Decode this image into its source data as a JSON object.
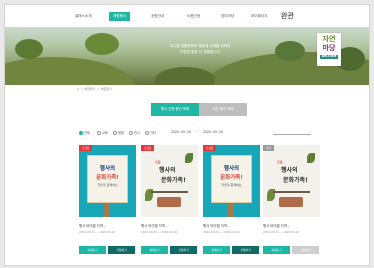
{
  "topnav": {
    "items": [
      "클래스소개",
      "체험행사",
      "공원안내",
      "이용신청",
      "참여마당",
      "마이페이지"
    ],
    "active_index": 1,
    "logo": "완관"
  },
  "hero": {
    "line1": "미니멀 생활문화의 향유에 사회를 위하여",
    "line2": "다양한 활동 더 경쟁합니다",
    "badge": [
      "자연",
      "마당",
      "WELCOME"
    ]
  },
  "breadcrumb": {
    "home": "⌂",
    "path": [
      "체험행사",
      "체험행사"
    ]
  },
  "tabs": {
    "active": "행사 진행 중인 목록",
    "inactive": "지난 행사 목록"
  },
  "filters": {
    "options": [
      "전체",
      "교육",
      "체험",
      "전시",
      "기타"
    ],
    "selected_index": 0,
    "date_from": "2020. 00. 00",
    "date_sep": "~",
    "date_to": "2020. 00. 00"
  },
  "cards": [
    {
      "tag": "모집중",
      "poster_line1": "행사의",
      "poster_line2": "문화가족!",
      "poster_line3": "자연과 함께하는",
      "title": "행사 마이벨 지역...",
      "date": "2020.00.00 ~ 2020.00.00",
      "btn_left": "상세보기",
      "btn_right": "신청하기"
    },
    {
      "tag": "모집중",
      "poster_line1": "행사의",
      "poster_line2": "문화가족!",
      "poster_line3": "모집",
      "title": "행사 마이벨 지역...",
      "date": "2020.00.00 ~ 2020.00.00",
      "btn_left": "상세보기",
      "btn_right": "신청하기"
    },
    {
      "tag": "모집중",
      "poster_line1": "행사의",
      "poster_line2": "문화가족!",
      "poster_line3": "자연과 함께하는",
      "title": "행사 마이벨 지역...",
      "date": "2020.00.00 ~ 2020.00.00",
      "btn_left": "상세보기",
      "btn_right": "신청하기"
    },
    {
      "tag": "마감",
      "poster_line1": "행사의",
      "poster_line2": "문화가족!",
      "poster_line3": "모집",
      "title": "행사 마이벨 지역...",
      "date": "2020.00.00 ~ 2020.00.00",
      "btn_left": "상세보기",
      "btn_right": "신청마감"
    }
  ],
  "colors": {
    "accent": "#1fb6a3",
    "dark_accent": "#0f6b66",
    "tag_red": "#e0393e",
    "poster_teal": "#18a7b7"
  }
}
